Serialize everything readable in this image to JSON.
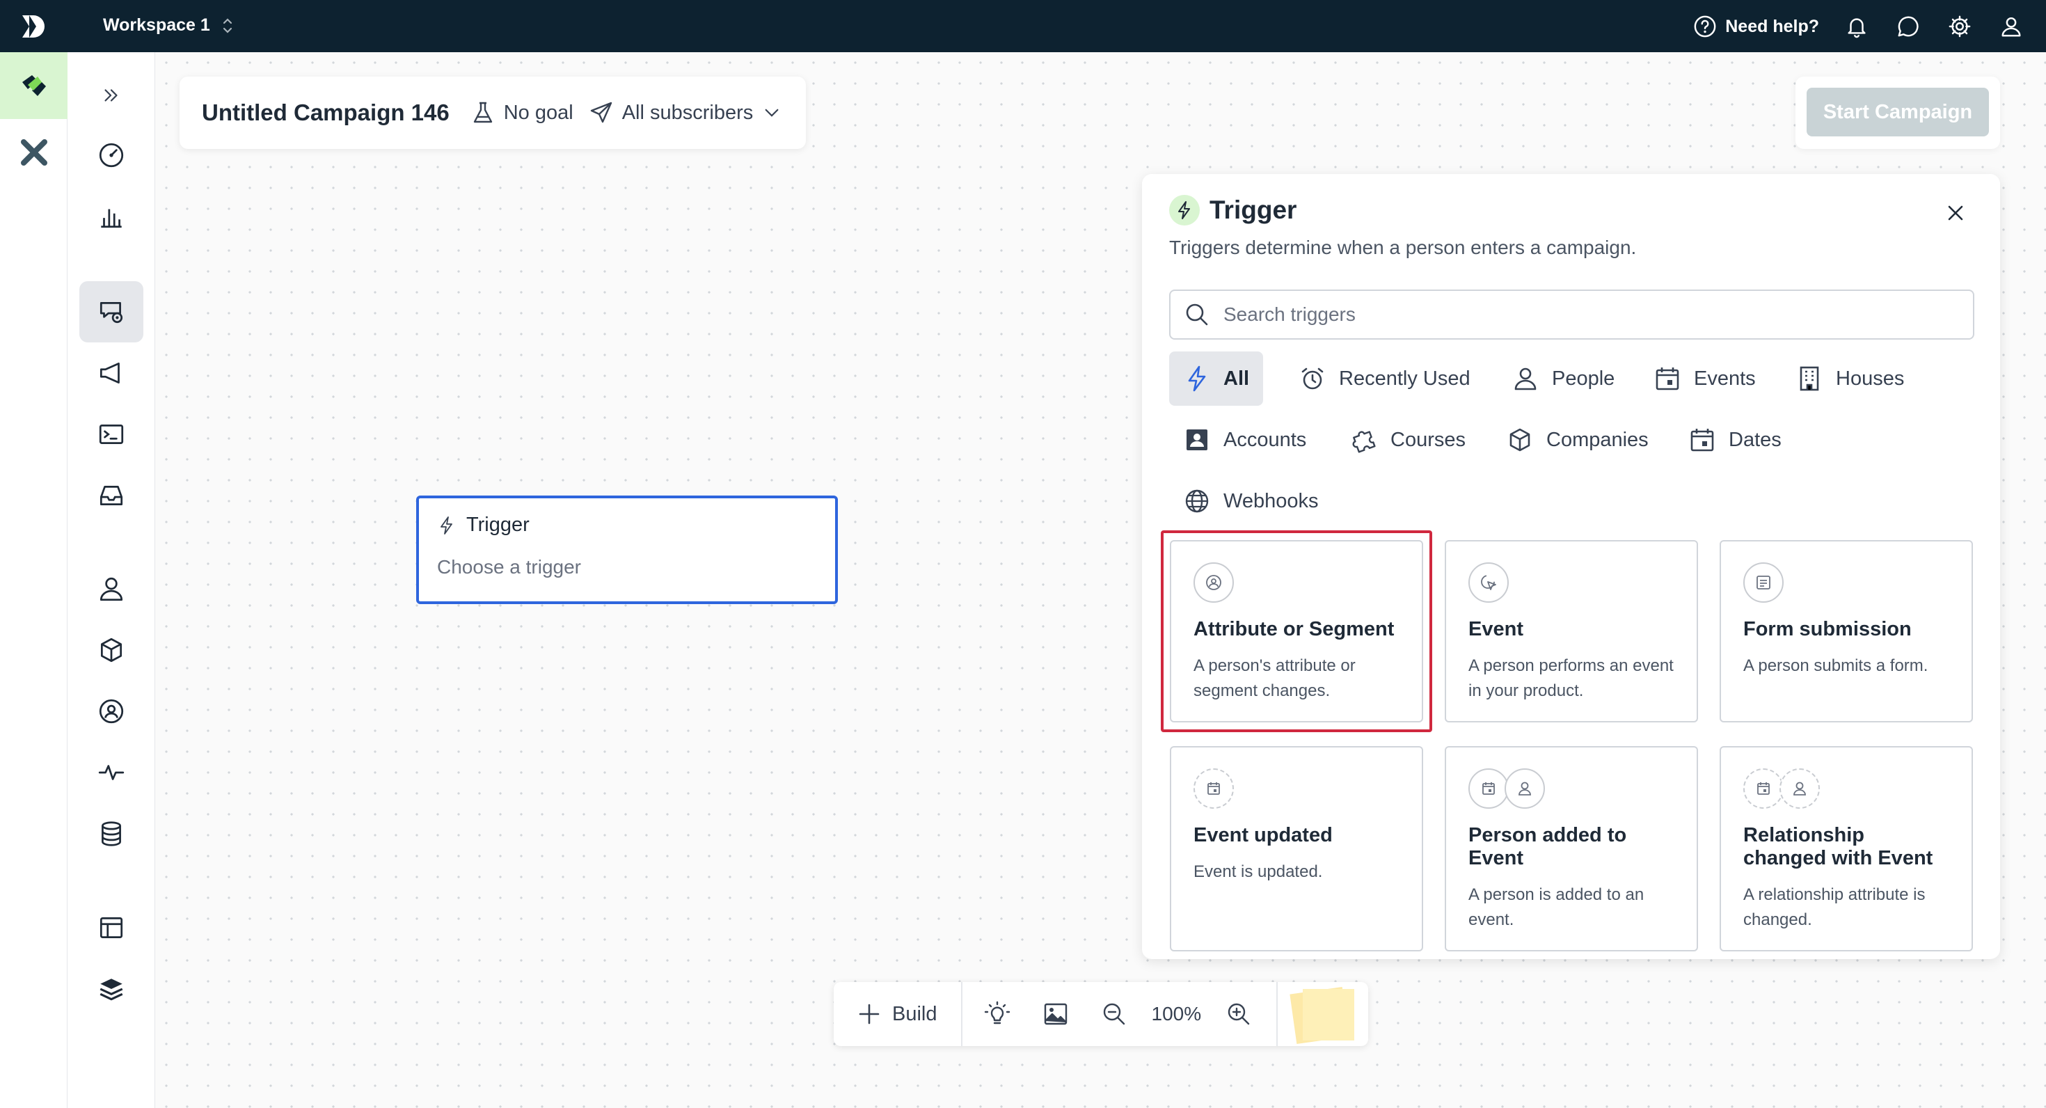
{
  "topbar": {
    "workspace": "Workspace 1",
    "help_label": "Need help?"
  },
  "campaign": {
    "title": "Untitled Campaign 146",
    "goal": "No goal",
    "audience": "All subscribers",
    "start_label": "Start Campaign"
  },
  "node": {
    "title": "Trigger",
    "subtitle": "Choose a trigger"
  },
  "panel": {
    "title": "Trigger",
    "description": "Triggers determine when a person enters a campaign.",
    "search_placeholder": "Search triggers",
    "categories": [
      "All",
      "Recently Used",
      "People",
      "Events",
      "Houses",
      "Accounts",
      "Courses",
      "Companies",
      "Dates",
      "Webhooks"
    ],
    "cards": [
      {
        "title": "Attribute or Segment",
        "desc": "A person's attribute or segment changes."
      },
      {
        "title": "Event",
        "desc": "A person performs an event in your product."
      },
      {
        "title": "Form submission",
        "desc": "A person submits a form."
      },
      {
        "title": "Event updated",
        "desc": "Event is updated."
      },
      {
        "title": "Person added to Event",
        "desc": "A person is added to an event."
      },
      {
        "title": "Relationship changed with Event",
        "desc": "A relationship attribute is changed."
      }
    ]
  },
  "toolbar": {
    "build_label": "Build",
    "zoom": "100%"
  },
  "colors": {
    "topbar": "#0d2230",
    "accent_blue": "#2e65dd",
    "highlight_red": "#d0283e",
    "brand_green": "#7ed957"
  },
  "icons": [
    "logo-icon",
    "help-icon",
    "bell-icon",
    "chat-icon",
    "gear-icon",
    "user-icon",
    "bolt-icon",
    "close-icon",
    "search-icon"
  ]
}
